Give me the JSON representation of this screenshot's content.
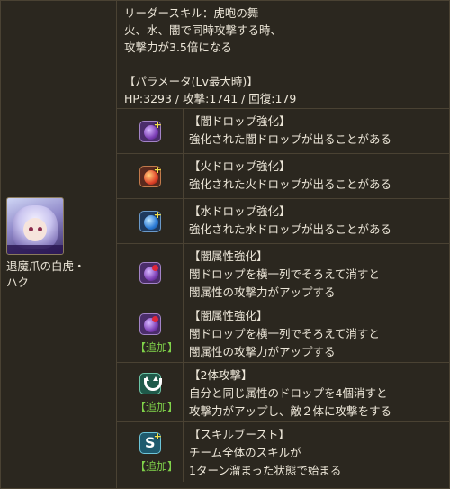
{
  "character": {
    "name_line1": "退魔爪の白虎・",
    "name_line2": "ハク"
  },
  "leader": {
    "title": "リーダースキル：虎咆の舞",
    "line1": "火、水、闇で同時攻撃する時、",
    "line2": "攻撃力が3.5倍になる",
    "param_header": "【パラメータ(Lv最大時)】",
    "stats": "HP:3293 / 攻撃:1741 / 回復:179"
  },
  "added_label": "【追加】",
  "awakenings": [
    {
      "icon": "dark-drop-enhance-icon",
      "title": "【闇ドロップ強化】",
      "desc": [
        "強化された闇ドロップが出ることがある"
      ]
    },
    {
      "icon": "fire-drop-enhance-icon",
      "title": "【火ドロップ強化】",
      "desc": [
        "強化された火ドロップが出ることがある"
      ]
    },
    {
      "icon": "water-drop-enhance-icon",
      "title": "【水ドロップ強化】",
      "desc": [
        "強化された水ドロップが出ることがある"
      ]
    },
    {
      "icon": "dark-row-enhance-icon",
      "title": "【闇属性強化】",
      "desc": [
        "闇ドロップを横一列でそろえて消すと",
        "闇属性の攻撃力がアップする"
      ]
    },
    {
      "icon": "dark-row-enhance-icon",
      "title": "【闇属性強化】",
      "desc": [
        "闇ドロップを横一列でそろえて消すと",
        "闇属性の攻撃力がアップする"
      ],
      "added": true
    },
    {
      "icon": "two-pronged-attack-icon",
      "title": "【2体攻撃】",
      "desc": [
        "自分と同じ属性のドロップを4個消すと",
        "攻撃力がアップし、敵２体に攻撃をする"
      ],
      "added": true
    },
    {
      "icon": "skill-boost-icon",
      "title": "【スキルブースト】",
      "desc": [
        "チーム全体のスキルが",
        "1ターン溜まった状態で始まる"
      ],
      "added": true
    }
  ]
}
